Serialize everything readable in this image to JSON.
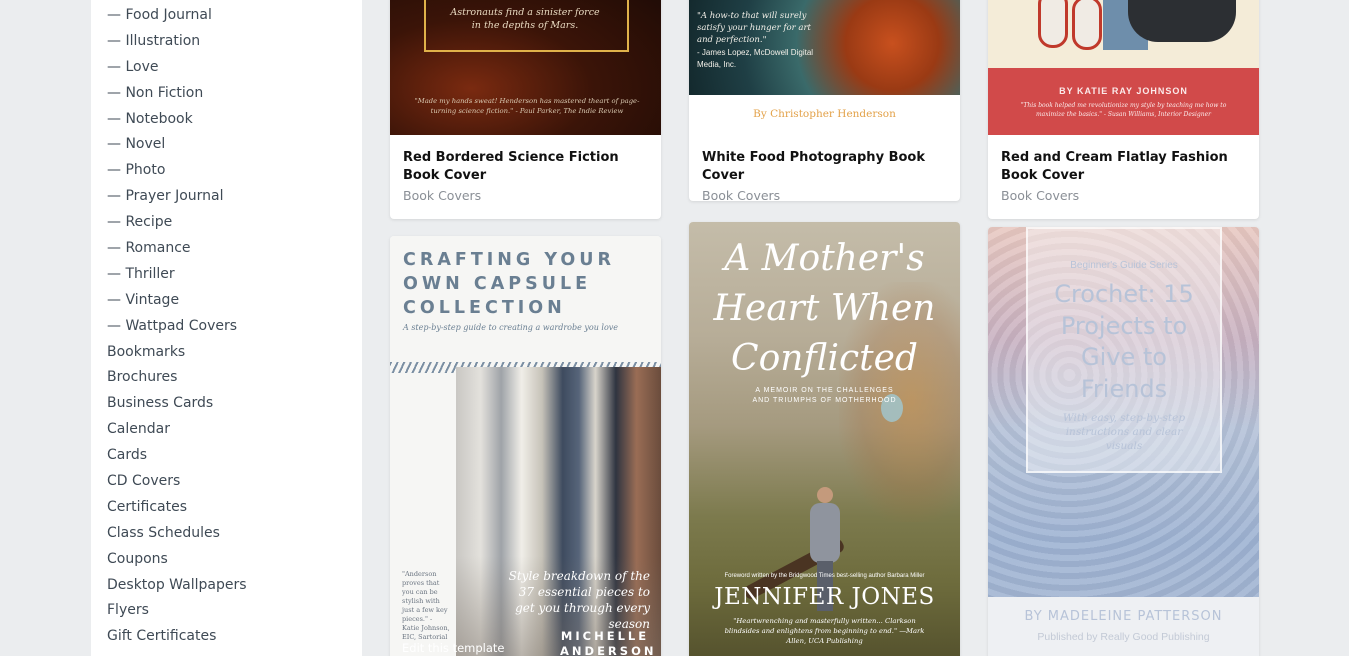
{
  "sidebar": {
    "items": [
      "— Food Journal",
      "— Illustration",
      "— Love",
      "— Non Fiction",
      "— Notebook",
      "— Novel",
      "— Photo",
      "— Prayer Journal",
      "— Recipe",
      "— Romance",
      "— Thriller",
      "— Vintage",
      "— Wattpad Covers",
      "Bookmarks",
      "Brochures",
      "Business Cards",
      "Calendar",
      "Cards",
      "CD Covers",
      "Certificates",
      "Class Schedules",
      "Coupons",
      "Desktop Wallpapers",
      "Flyers",
      "Gift Certificates"
    ]
  },
  "cards": {
    "scifi": {
      "title": "Red Bordered Science Fiction Book Cover",
      "category": "Book Covers",
      "cover_tagline": "Astronauts find a sinister force in the depths of Mars.",
      "cover_quote": "\"Made my hands sweat! Henderson has mastered theart of page-turning science fiction.\" - Paul Parker, The Indie Review"
    },
    "food": {
      "title": "White Food Photography Book Cover",
      "category": "Book Covers",
      "cover_quote": "\"A how-to that will surely satisfy your hunger for art and perfection.\"",
      "cover_quote_author": "- James Lopez, McDowell Digital Media, Inc.",
      "cover_author": "By Christopher Henderson"
    },
    "flatlay": {
      "title": "Red and Cream Flatlay Fashion Book Cover",
      "category": "Book Covers",
      "cover_author": "BY KATIE RAY JOHNSON",
      "cover_quote": "\"This book helped me revolutionize my style by teaching me how to maximize the basics.\" - Susan Williams, Interior Designer"
    },
    "capsule": {
      "cover_title": "CRAFTING YOUR OWN CAPSULE COLLECTION",
      "cover_subtitle": "A step-by-step guide to creating a wardrobe you love",
      "cover_side_quote": "\"Anderson proves that you can be stylish with just a few key pieces.\" - Katie Johnson, EIC, Sartorial",
      "cover_breakdown": "Style breakdown of the 37 essential pieces to get you through every season",
      "cover_author": "MICHELLE ANDERSON",
      "edit_label": "Edit this template"
    },
    "mother": {
      "cover_title": "A Mother's Heart When Conflicted",
      "cover_subtitle": "A MEMOIR ON THE CHALLENGES AND TRIUMPHS OF MOTHERHOOD",
      "cover_foreword": "Foreword written by the Bridgwood Times best-selling author Barbara Miller",
      "cover_author": "JENNIFER JONES",
      "cover_quote": "\"Heartwrenching and masterfully written... Clarkson blindsides and enlightens from beginning to end.\" —Mark Allen, UCA Publishing"
    },
    "crochet": {
      "cover_series": "Beginner's Guide Series",
      "cover_title": "Crochet: 15 Projects to Give to Friends",
      "cover_subtitle": "With easy, step-by-step instructions and clear visuals",
      "cover_author": "BY MADELEINE PATTERSON",
      "cover_publisher": "Published by Really Good Publishing"
    }
  },
  "colors": {
    "background": "#ebedef",
    "sidebar_text": "#3f4a55",
    "flatlay_band": "#d14a4a",
    "food_author": "#e3a24a"
  }
}
